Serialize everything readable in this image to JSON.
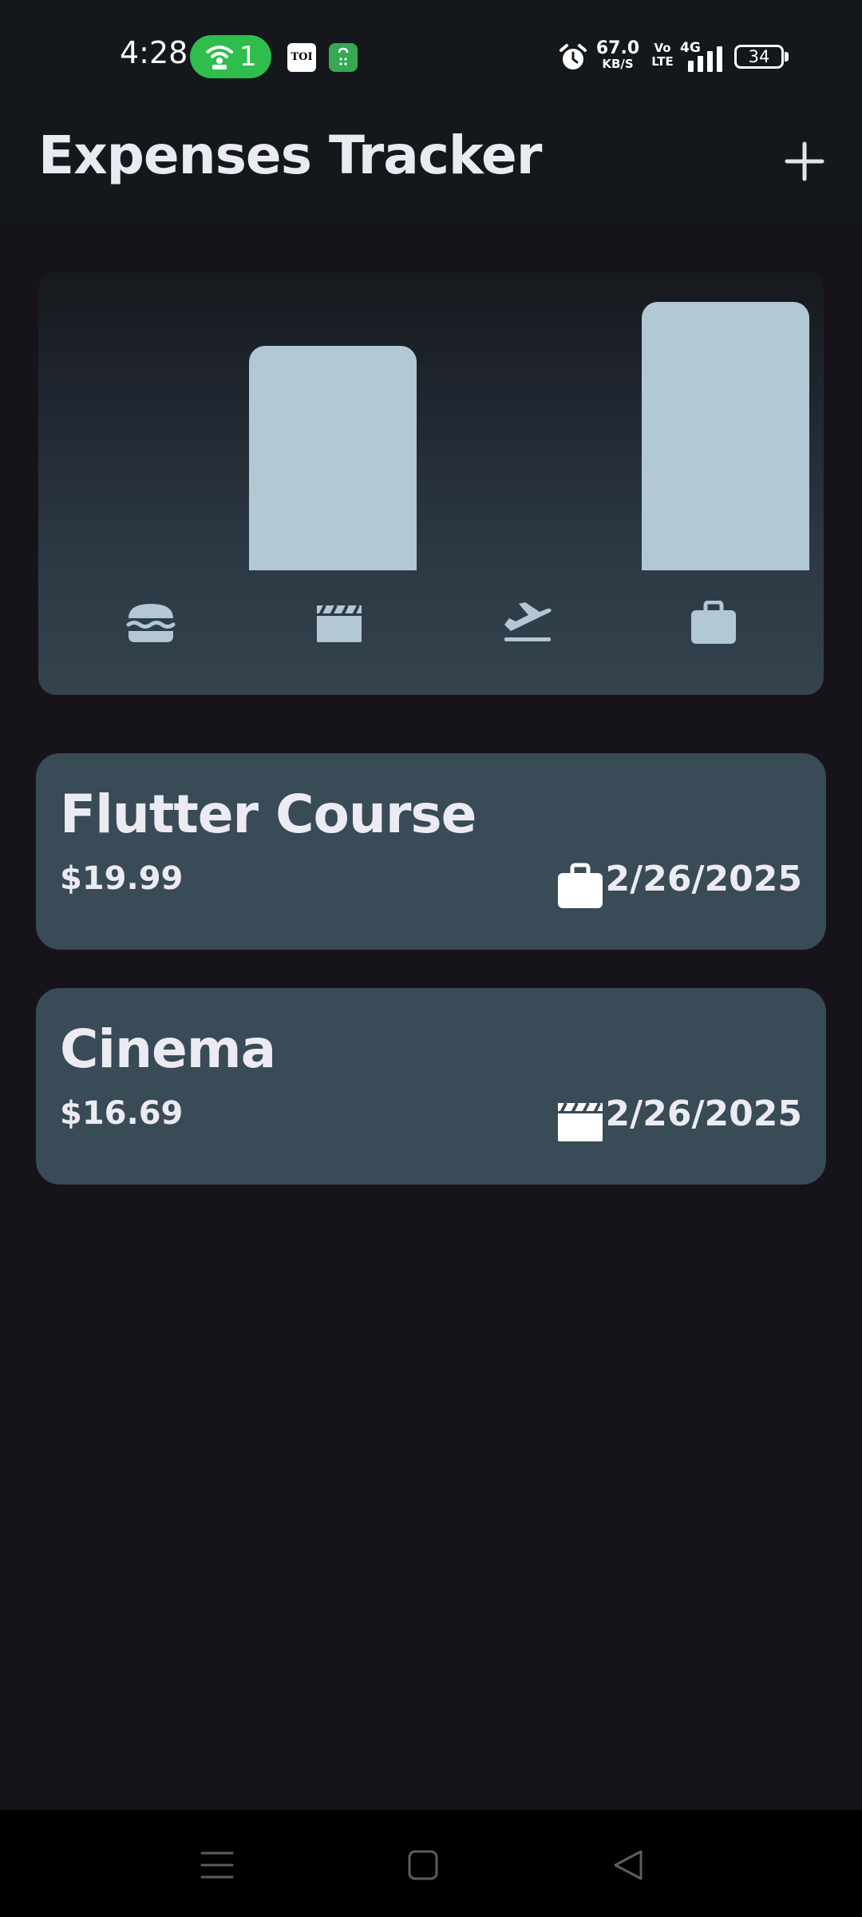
{
  "status_bar": {
    "time": "4:28",
    "hotspot_count": "1",
    "toi_label": "TOI",
    "net_speed_value": "67.0",
    "net_speed_unit": "KB/S",
    "volte_top": "Vo",
    "volte_bottom": "LTE",
    "network_type": "4G",
    "battery": "34"
  },
  "app_bar": {
    "title": "Expenses Tracker",
    "add_icon": "plus-icon"
  },
  "chart_data": {
    "type": "bar",
    "categories": [
      "food",
      "leisure",
      "travel",
      "work"
    ],
    "category_icons": [
      "burger-icon",
      "clapperboard-icon",
      "airplane-departure-icon",
      "briefcase-icon"
    ],
    "values": [
      0,
      16.69,
      0,
      19.99
    ],
    "ylim": [
      0,
      19.99
    ],
    "bar_color": "#b2c8d4"
  },
  "expenses": [
    {
      "title": "Flutter Course",
      "amount": "$19.99",
      "category_icon": "briefcase-icon",
      "date": "2/26/2025"
    },
    {
      "title": "Cinema",
      "amount": "$16.69",
      "category_icon": "clapperboard-icon",
      "date": "2/26/2025"
    }
  ],
  "colors": {
    "background": "#16141a",
    "card": "#384b56",
    "accent": "#b2c8d4",
    "hotspot": "#2fbe4c"
  },
  "nav_bar": {
    "items": [
      "menu-icon",
      "home-square-icon",
      "back-triangle-icon"
    ]
  }
}
